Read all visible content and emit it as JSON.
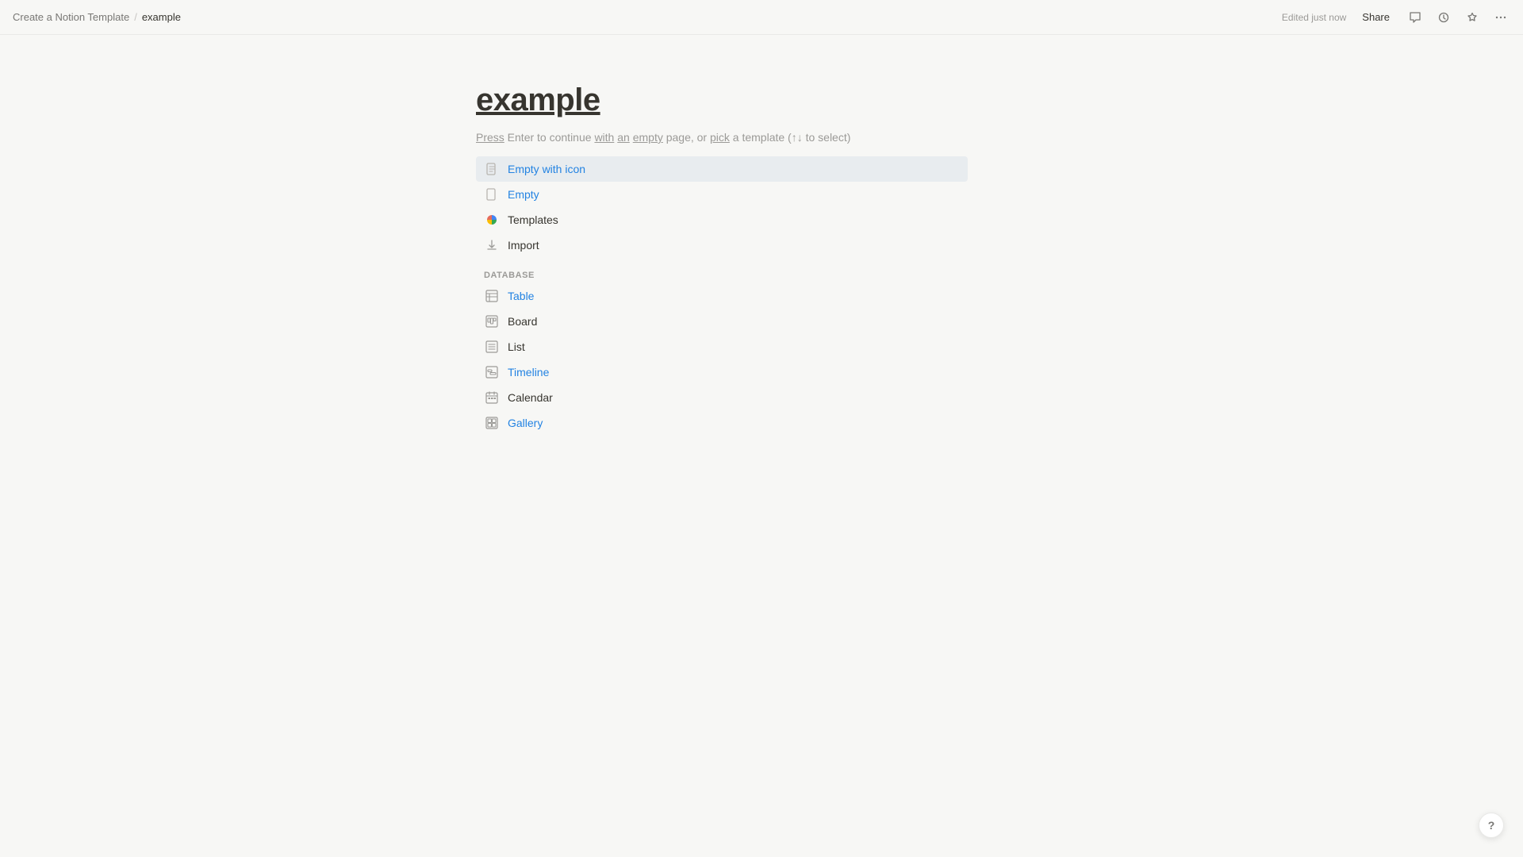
{
  "topbar": {
    "breadcrumb_parent": "Create a Notion Template",
    "breadcrumb_separator": "/",
    "breadcrumb_current": "example",
    "edited_text": "Edited just now",
    "share_label": "Share",
    "comment_icon": "💬",
    "history_icon": "⏱",
    "favorite_icon": "☆",
    "more_icon": "···"
  },
  "page": {
    "title": "example",
    "hint": "Press Enter to continue with an empty page, or pick a template (↑↓ to select)"
  },
  "menu": {
    "items": [
      {
        "id": "empty-with-icon",
        "label": "Empty with icon",
        "icon_type": "doc",
        "active": true
      },
      {
        "id": "empty",
        "label": "Empty",
        "icon_type": "doc",
        "active": false
      },
      {
        "id": "templates",
        "label": "Templates",
        "icon_type": "templates",
        "active": false
      },
      {
        "id": "import",
        "label": "Import",
        "icon_type": "import",
        "active": false
      }
    ],
    "database_section_label": "DATABASE",
    "database_items": [
      {
        "id": "table",
        "label": "Table"
      },
      {
        "id": "board",
        "label": "Board"
      },
      {
        "id": "list",
        "label": "List"
      },
      {
        "id": "timeline",
        "label": "Timeline"
      },
      {
        "id": "calendar",
        "label": "Calendar"
      },
      {
        "id": "gallery",
        "label": "Gallery"
      }
    ]
  },
  "help": {
    "label": "?"
  }
}
